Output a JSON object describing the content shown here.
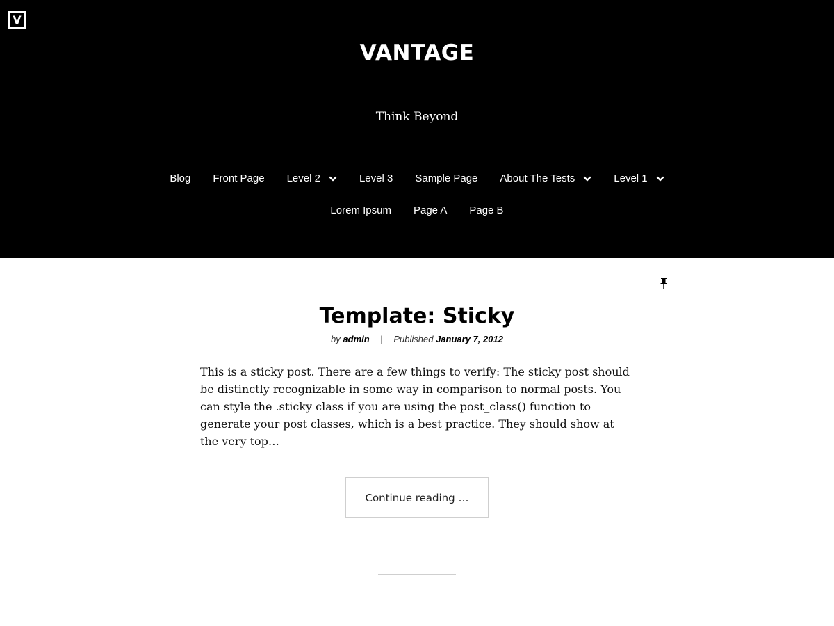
{
  "header": {
    "logo_letter": "V",
    "site_title": "VANTAGE",
    "tagline": "Think Beyond"
  },
  "nav": {
    "row1": [
      {
        "label": "Blog",
        "has_submenu": false
      },
      {
        "label": "Front Page",
        "has_submenu": false
      },
      {
        "label": "Level 2",
        "has_submenu": true
      },
      {
        "label": "Level 3",
        "has_submenu": false
      },
      {
        "label": "Sample Page",
        "has_submenu": false
      },
      {
        "label": "About The Tests",
        "has_submenu": true
      },
      {
        "label": "Level 1",
        "has_submenu": true
      }
    ],
    "row2": [
      {
        "label": "Lorem Ipsum",
        "has_submenu": false
      },
      {
        "label": "Page A",
        "has_submenu": false
      },
      {
        "label": "Page B",
        "has_submenu": false
      }
    ]
  },
  "post": {
    "sticky_icon": "pushpin-icon",
    "title": "Template: Sticky",
    "by_label": "by",
    "author": "admin",
    "separator": "|",
    "published_label": "Published",
    "date": "January 7, 2012",
    "excerpt": "This is a sticky post. There are a few things to verify: The sticky post should be distinctly recognizable in some way in comparison to normal posts. You can style the .sticky class if you are using the post_class() function to generate your post classes, which is a best practice. They should show at the very top…",
    "continue_label": "Continue reading …"
  },
  "colors": {
    "header_bg": "#000000",
    "text_on_dark": "#ffffff",
    "body_bg": "#ffffff",
    "button_border": "#cfcfcf"
  }
}
